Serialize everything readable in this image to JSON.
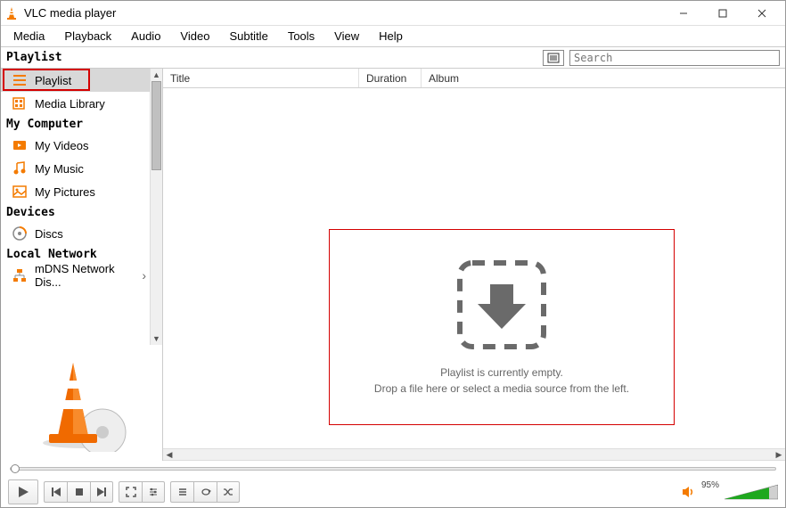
{
  "window": {
    "title": "VLC media player"
  },
  "menu": {
    "items": [
      "Media",
      "Playback",
      "Audio",
      "Video",
      "Subtitle",
      "Tools",
      "View",
      "Help"
    ]
  },
  "header": {
    "label": "Playlist",
    "search_placeholder": "Search"
  },
  "sidebar": {
    "sections": [
      {
        "header": null,
        "items": [
          {
            "label": "Playlist",
            "icon": "playlist-icon",
            "selected": true
          },
          {
            "label": "Media Library",
            "icon": "media-library-icon",
            "selected": false
          }
        ]
      },
      {
        "header": "My Computer",
        "items": [
          {
            "label": "My Videos",
            "icon": "video-icon",
            "selected": false
          },
          {
            "label": "My Music",
            "icon": "music-icon",
            "selected": false
          },
          {
            "label": "My Pictures",
            "icon": "pictures-icon",
            "selected": false
          }
        ]
      },
      {
        "header": "Devices",
        "items": [
          {
            "label": "Discs",
            "icon": "disc-icon",
            "selected": false
          }
        ]
      },
      {
        "header": "Local Network",
        "items": [
          {
            "label": "mDNS Network Dis...",
            "icon": "network-icon",
            "selected": false
          }
        ]
      }
    ]
  },
  "columns": {
    "title": "Title",
    "duration": "Duration",
    "album": "Album"
  },
  "empty": {
    "line1": "Playlist is currently empty.",
    "line2": "Drop a file here or select a media source from the left."
  },
  "volume": {
    "percent": "95%"
  }
}
